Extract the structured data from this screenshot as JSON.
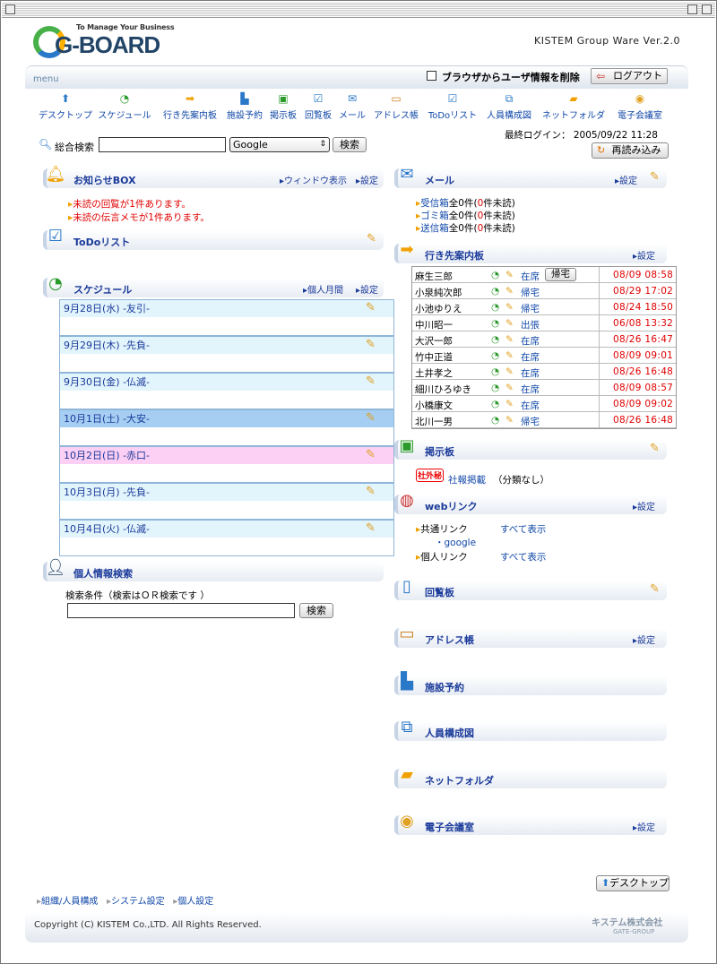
{
  "header": {
    "tagline": "To Manage Your Business",
    "logo": "G-BOARD",
    "version": "KISTEM Group Ware Ver.2.0"
  },
  "menubar": {
    "menu_label": "menu",
    "delete_label": "ブラウザからユーザ情報を削除",
    "logout_label": "ログアウト"
  },
  "nav": [
    {
      "label": "デスクトップ",
      "icon": "up-arrow-icon"
    },
    {
      "label": "スケジュール",
      "icon": "clock-icon"
    },
    {
      "label": "行き先案内板",
      "icon": "arrow-icon"
    },
    {
      "label": "施設予約",
      "icon": "building-icon"
    },
    {
      "label": "掲示板",
      "icon": "board-icon"
    },
    {
      "label": "回覧板",
      "icon": "circular-icon"
    },
    {
      "label": "メール",
      "icon": "mail-icon"
    },
    {
      "label": "アドレス帳",
      "icon": "address-book-icon"
    },
    {
      "label": "ToDoリスト",
      "icon": "todo-icon"
    },
    {
      "label": "人員構成図",
      "icon": "org-chart-icon"
    },
    {
      "label": "ネットフォルダ",
      "icon": "folder-icon"
    },
    {
      "label": "電子会議室",
      "icon": "conference-icon"
    }
  ],
  "search": {
    "label": "総合検索",
    "value": "",
    "engine": "Google",
    "button": "検索"
  },
  "login": {
    "text": "最終ログイン： 2005/09/22 11:28",
    "reload": "再読み込み"
  },
  "notice": {
    "title": "お知らせBOX",
    "window_link": "ウィンドウ表示",
    "settings": "設定",
    "items": [
      "未読の回覧が1件あります。",
      "未読の伝言メモが1件あります。"
    ]
  },
  "todo": {
    "title": "ToDoリスト"
  },
  "schedule": {
    "title": "スケジュール",
    "monthly": "個人月間",
    "settings": "設定",
    "days": [
      {
        "label": "9月28日(水) -友引-",
        "bg": "#e2f4fc"
      },
      {
        "label": "9月29日(木) -先負-",
        "bg": "#e2f4fc"
      },
      {
        "label": "9月30日(金) -仏滅-",
        "bg": "#e2f4fc"
      },
      {
        "label": "10月1日(土) -大安-",
        "bg": "#a6cef2"
      },
      {
        "label": "10月2日(日) -赤口-",
        "bg": "#fccff4"
      },
      {
        "label": "10月3日(月) -先負-",
        "bg": "#e2f4fc"
      },
      {
        "label": "10月4日(火) -仏滅-",
        "bg": "#e2f4fc"
      }
    ]
  },
  "person_search": {
    "title": "個人情報検索",
    "condition": "検索条件（検索はＯＲ検索です ）",
    "value": "",
    "button": "検索"
  },
  "mail": {
    "title": "メール",
    "settings": "設定",
    "boxes": [
      {
        "name": "受信箱",
        "pre": "全0件(",
        "num": "0",
        "post": "件未読)"
      },
      {
        "name": "ゴミ箱",
        "pre": "全0件(",
        "num": "0",
        "post": "件未読)"
      },
      {
        "name": "送信箱",
        "pre": "全0件(",
        "num": "0",
        "post": "件未読)"
      }
    ]
  },
  "destination": {
    "title": "行き先案内板",
    "settings": "設定",
    "go_home": "帰宅",
    "rows": [
      {
        "name": "麻生三郎",
        "status": "在席",
        "time": "08/09 08:58"
      },
      {
        "name": "小泉純次郎",
        "status": "帰宅",
        "time": "08/29 17:02"
      },
      {
        "name": "小池ゆりえ",
        "status": "帰宅",
        "time": "08/24 18:50"
      },
      {
        "name": "中川昭一",
        "status": "出張",
        "time": "06/08 13:32"
      },
      {
        "name": "大沢一郎",
        "status": "在席",
        "time": "08/26 16:47"
      },
      {
        "name": "竹中正道",
        "status": "在席",
        "time": "08/09 09:01"
      },
      {
        "name": "土井孝之",
        "status": "在席",
        "time": "08/26 16:48"
      },
      {
        "name": "細川ひろゆき",
        "status": "在席",
        "time": "08/09 08:57"
      },
      {
        "name": "小橋康文",
        "status": "在席",
        "time": "08/09 09:02"
      },
      {
        "name": "北川一男",
        "status": "帰宅",
        "time": "08/26 16:48"
      }
    ]
  },
  "bbs": {
    "title": "掲示板",
    "badge": "社外秘",
    "item": "社報掲載",
    "item_suffix": "（分類なし）"
  },
  "weblink": {
    "title": "webリンク",
    "settings": "設定",
    "common": "共通リンク",
    "show_all": "すべて表示",
    "google": "・google",
    "personal": "個人リンク",
    "show_all2": "すべて表示"
  },
  "circular": {
    "title": "回覧板"
  },
  "address": {
    "title": "アドレス帳",
    "settings": "設定"
  },
  "facility": {
    "title": "施設予約"
  },
  "org": {
    "title": "人員構成図"
  },
  "netfolder": {
    "title": "ネットフォルダ"
  },
  "conference": {
    "title": "電子会議室",
    "settings": "設定"
  },
  "footer": {
    "desktop_button": "デスクトップ",
    "links": [
      "組織/人員構成",
      "システム設定",
      "個人設定"
    ],
    "copyright": "Copyright (C) KISTEM Co.,LTD. All Rights Reserved.",
    "company": "キステム株式会社",
    "group": "GATE-GROUP"
  }
}
